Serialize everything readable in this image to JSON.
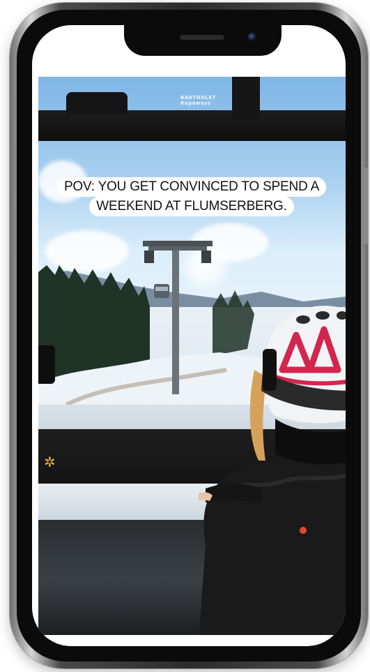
{
  "device": {
    "frame_color": "#2b2b2b",
    "screen_color": "#ffffff"
  },
  "video": {
    "caption_lines": [
      "POV: YOU GET CONVINCED TO SPEND A",
      "WEEKEND AT FLUMSERBERG."
    ],
    "sticker": {
      "brand_line1": "BARTHOLET",
      "brand_line2": "Ropeways"
    },
    "helmet_accent_color": "#d3264f"
  }
}
